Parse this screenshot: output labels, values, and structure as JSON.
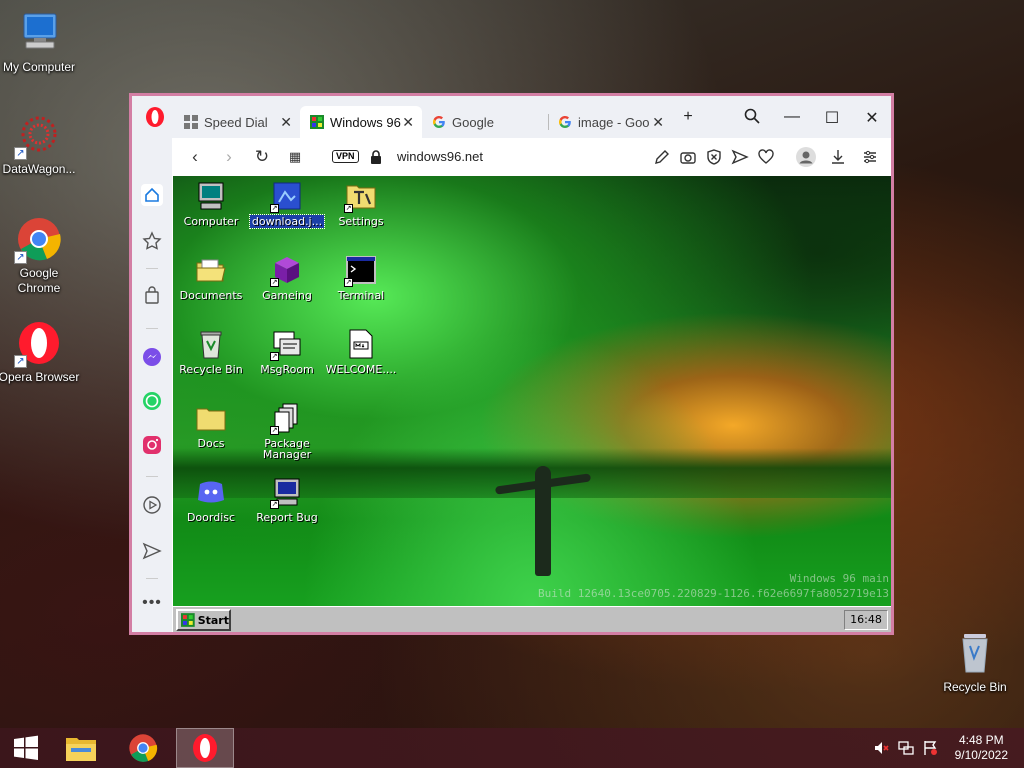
{
  "desktop": {
    "icons": [
      {
        "label": "My Computer",
        "icon": "computer-icon"
      },
      {
        "label": "DataWagon...",
        "icon": "datawagon-icon"
      },
      {
        "label": "Google Chrome",
        "icon": "chrome-icon"
      },
      {
        "label": "Opera Browser",
        "icon": "opera-icon"
      },
      {
        "label": "Recycle Bin",
        "icon": "recycle-bin-icon"
      }
    ]
  },
  "browser": {
    "tabs": [
      {
        "label": "Speed Dial",
        "icon": "speed-dial-icon"
      },
      {
        "label": "Windows 96",
        "icon": "windows96-icon",
        "active": true
      },
      {
        "label": "Google",
        "icon": "google-icon"
      },
      {
        "label": "image - Goo",
        "icon": "google-icon"
      }
    ],
    "vpn_label": "VPN",
    "url": "windows96.net",
    "accent_color": "#d37ea4"
  },
  "w96": {
    "icons": [
      {
        "label": "Computer"
      },
      {
        "label": "download.j...",
        "selected": true
      },
      {
        "label": "Settings"
      },
      {
        "label": "Documents"
      },
      {
        "label": "Gameing"
      },
      {
        "label": "Terminal"
      },
      {
        "label": "Recycle Bin"
      },
      {
        "label": "MsgRoom"
      },
      {
        "label": "WELCOME...."
      },
      {
        "label": "Docs"
      },
      {
        "label": "Package Manager"
      },
      {
        "label": "Doordisc"
      },
      {
        "label": "Report Bug"
      }
    ],
    "watermark_line1": "Windows 96 main",
    "watermark_line2": "Build 12640.13ce0705.220829-1126.f62e6697fa8052719e13",
    "start_label": "Start",
    "clock": "16:48"
  },
  "taskbar": {
    "time": "4:48 PM",
    "date": "9/10/2022"
  }
}
